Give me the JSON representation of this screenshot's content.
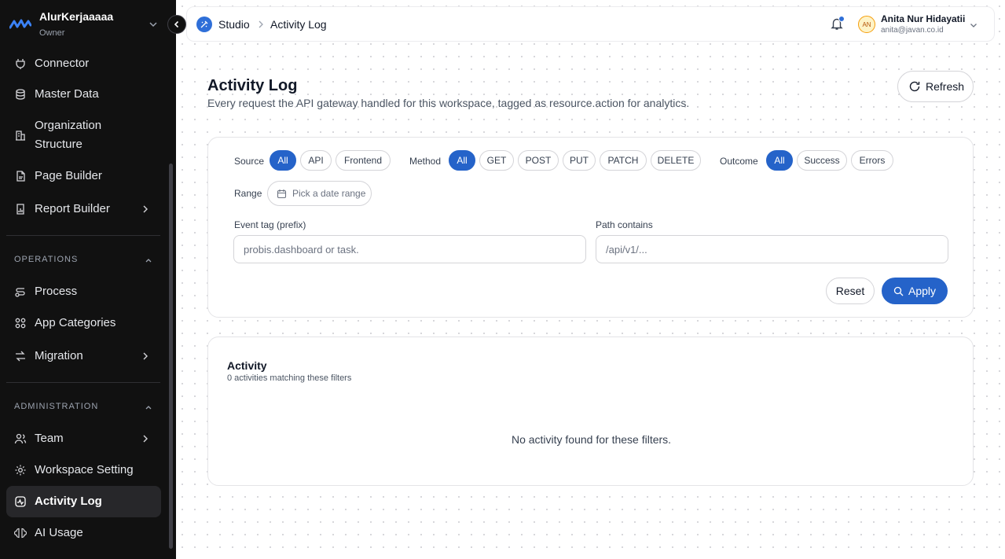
{
  "workspace": {
    "name": "AlurKerjaaaaa",
    "role": "Owner"
  },
  "sidebar": {
    "items_top": [
      {
        "label": "Connector",
        "icon": "plug-icon"
      },
      {
        "label": "Master Data",
        "icon": "database-icon"
      },
      {
        "label": "Organization Structure",
        "icon": "building-icon"
      },
      {
        "label": "Page Builder",
        "icon": "page-icon"
      },
      {
        "label": "Report Builder",
        "icon": "report-icon"
      }
    ],
    "org_line1": "Organization",
    "org_line2": "Structure",
    "operations_label": "OPERATIONS",
    "operations": [
      {
        "label": "Process",
        "icon": "workflow-icon"
      },
      {
        "label": "App Categories",
        "icon": "categories-icon"
      },
      {
        "label": "Migration",
        "icon": "migration-icon"
      }
    ],
    "administration_label": "ADMINISTRATION",
    "administration": [
      {
        "label": "Team",
        "icon": "team-icon"
      },
      {
        "label": "Workspace Setting",
        "icon": "gear-icon"
      },
      {
        "label": "Activity Log",
        "icon": "activity-icon",
        "active": true
      },
      {
        "label": "AI Usage",
        "icon": "ai-icon"
      }
    ]
  },
  "topbar": {
    "breadcrumb_root": "Studio",
    "breadcrumb_current": "Activity Log",
    "user_initials": "AN",
    "user_name": "Anita Nur Hidayatii",
    "user_email": "anita@javan.co.id"
  },
  "page": {
    "title": "Activity Log",
    "subtitle": "Every request the API gateway handled for this workspace, tagged as resource.action for analytics.",
    "refresh_label": "Refresh"
  },
  "filters": {
    "source_label": "Source",
    "source_options": [
      "All",
      "API",
      "Frontend"
    ],
    "method_label": "Method",
    "method_options": [
      "All",
      "GET",
      "POST",
      "PUT",
      "PATCH",
      "DELETE"
    ],
    "outcome_label": "Outcome",
    "outcome_options": [
      "All",
      "Success",
      "Errors"
    ],
    "range_label": "Range",
    "range_placeholder": "Pick a date range",
    "event_tag_label": "Event tag (prefix)",
    "event_tag_placeholder": "probis.dashboard or task.",
    "path_label": "Path contains",
    "path_placeholder": "/api/v1/...",
    "reset_label": "Reset",
    "apply_label": "Apply"
  },
  "activity": {
    "title": "Activity",
    "count_text": "0 activities matching these filters",
    "empty_text": "No activity found for these filters."
  },
  "colors": {
    "accent": "#2563c9",
    "sidebar_bg": "#111111"
  }
}
